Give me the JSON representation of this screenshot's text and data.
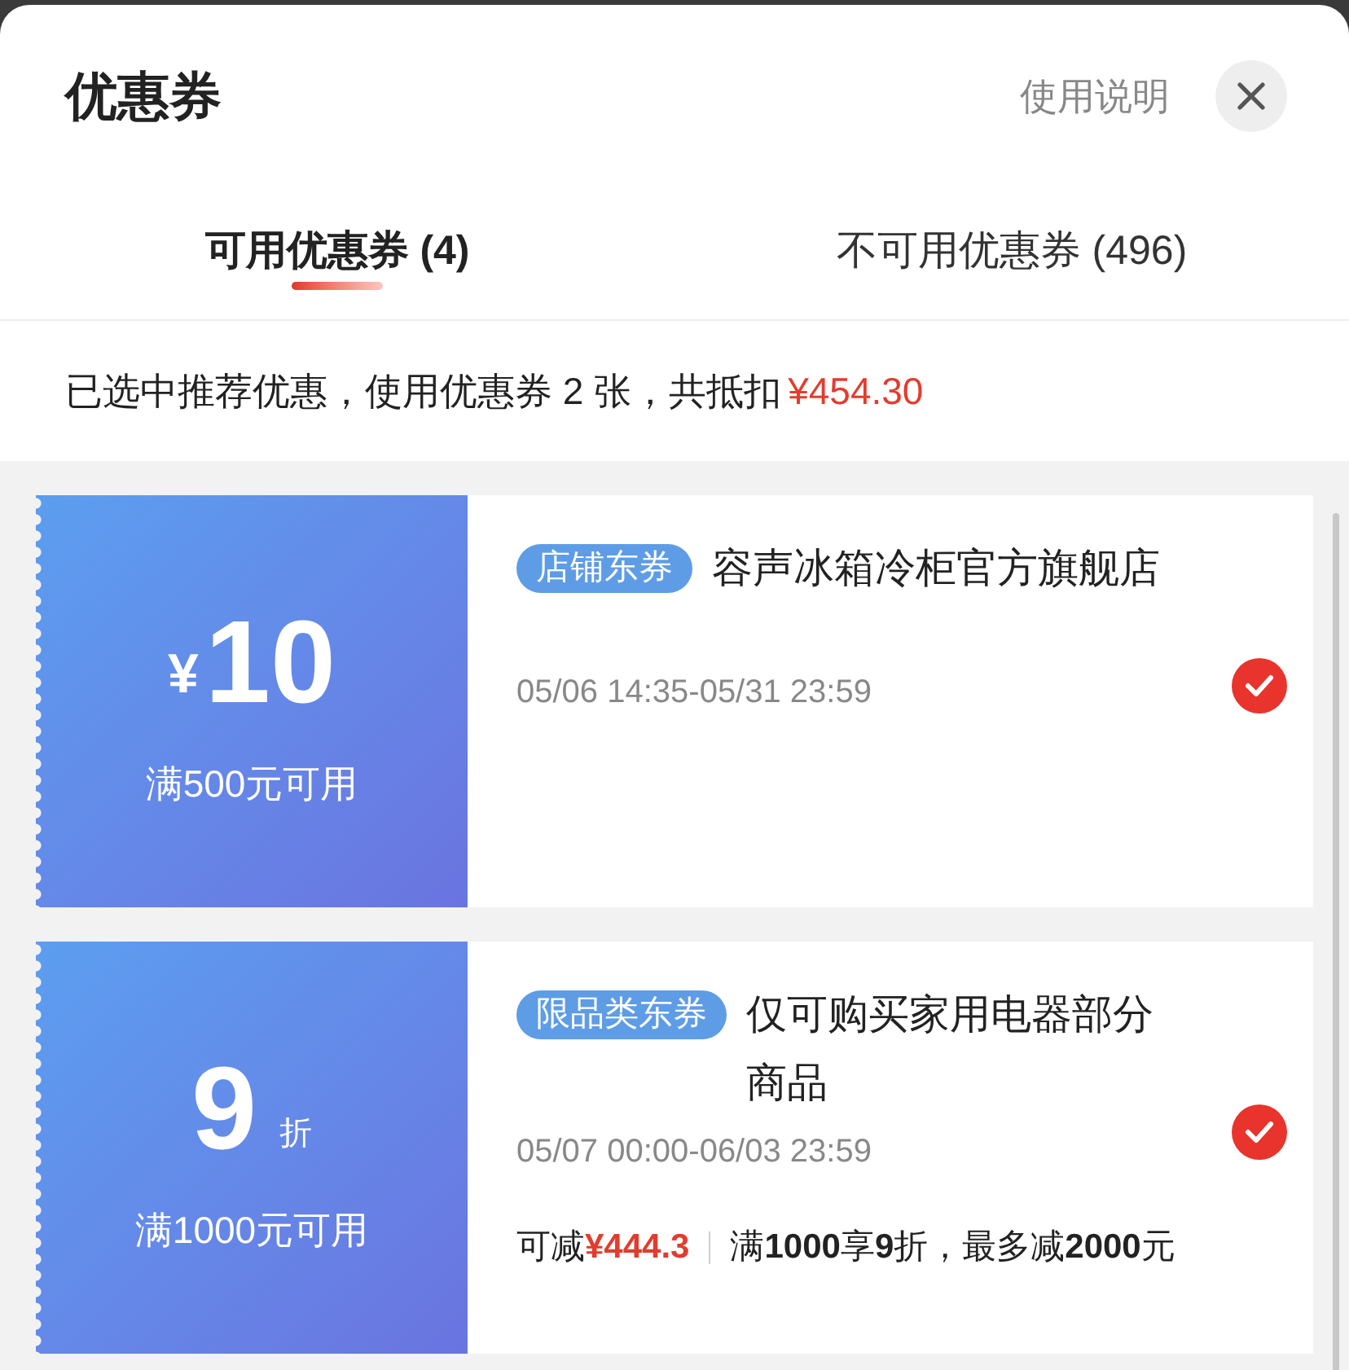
{
  "sheet": {
    "title": "优惠券",
    "help_link": "使用说明"
  },
  "tabs": [
    {
      "label": "可用优惠券 (4)",
      "selected": true
    },
    {
      "label": "不可用优惠券 (496)",
      "selected": false
    }
  ],
  "summary": {
    "text": "已选中推荐优惠，使用优惠券 2 张，共抵扣",
    "amount": "¥454.30"
  },
  "coupons": [
    {
      "kind": "cash",
      "currency": "¥",
      "value": "10",
      "condition": "满500元可用",
      "tag": "店铺东券",
      "title": "容声冰箱冷柜官方旗舰店",
      "validity": "05/06 14:35-05/31 23:59",
      "selected": true
    },
    {
      "kind": "discount",
      "value": "9",
      "unit": "折",
      "condition": "满1000元可用",
      "tag": "限品类东券",
      "title": "仅可购买家用电器部分商品",
      "validity": "05/07 00:00-06/03 23:59",
      "saving": {
        "label": "可减",
        "amount": "¥444.3"
      },
      "rule": "满**1000**享**9**折，最多减**2000**元",
      "selected": true
    }
  ]
}
